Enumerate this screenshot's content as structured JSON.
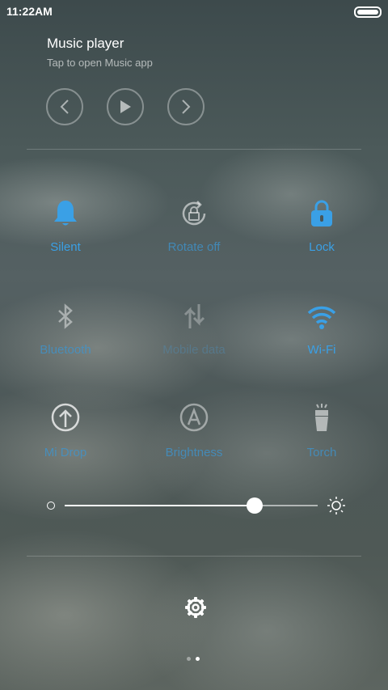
{
  "status_bar": {
    "time": "11:22AM"
  },
  "music": {
    "title": "Music player",
    "subtitle": "Tap to open Music app",
    "controls": [
      "previous-icon",
      "play-icon",
      "next-icon"
    ]
  },
  "toggles": [
    {
      "label": "Silent",
      "icon": "bell-icon",
      "state": "on"
    },
    {
      "label": "Rotate off",
      "icon": "rotate-lock-icon",
      "state": "off"
    },
    {
      "label": "Lock",
      "icon": "lock-icon",
      "state": "on"
    },
    {
      "label": "Bluetooth",
      "icon": "bluetooth-icon",
      "state": "off"
    },
    {
      "label": "Mobile data",
      "icon": "mobile-data-icon",
      "state": "disabled"
    },
    {
      "label": "Wi-Fi",
      "icon": "wifi-icon",
      "state": "on"
    },
    {
      "label": "Mi Drop",
      "icon": "upload-icon",
      "state": "off"
    },
    {
      "label": "Brightness",
      "icon": "auto-brightness-icon",
      "state": "off"
    },
    {
      "label": "Torch",
      "icon": "torch-icon",
      "state": "off"
    }
  ],
  "brightness": {
    "level": 0.75
  },
  "pager": {
    "pages": 2,
    "current": 2
  },
  "colors": {
    "active": "#3aa0e6",
    "inactive": "#3c96d2"
  }
}
